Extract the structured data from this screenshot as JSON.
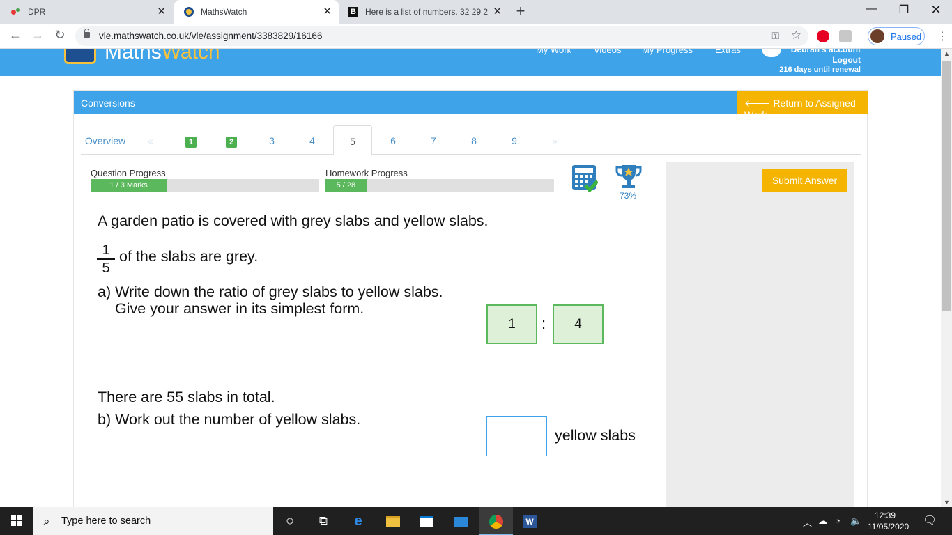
{
  "browser": {
    "tabs": [
      {
        "title": "DPR",
        "active": false
      },
      {
        "title": "MathsWatch",
        "active": true
      },
      {
        "title": "Here is a list of numbers. 32 29 2",
        "active": false
      }
    ],
    "url": "vle.mathswatch.co.uk/vle/assignment/3383829/16166",
    "profile_status": "Paused"
  },
  "site": {
    "logo_left": "Maths",
    "logo_right": "Watch",
    "nav": [
      "My Work",
      "Videos",
      "My Progress",
      "Extras"
    ],
    "account": "Debrah's account",
    "logout": "Logout",
    "renewal": "216 days until renewal"
  },
  "panel": {
    "title": "Conversions",
    "return_label": "Return to Assigned Work",
    "overview_label": "Overview",
    "prev_arrow": "«",
    "next_arrow": "»",
    "question_tabs": [
      {
        "label": "1",
        "state": "done"
      },
      {
        "label": "2",
        "state": "done"
      },
      {
        "label": "3",
        "state": "todo"
      },
      {
        "label": "4",
        "state": "todo"
      },
      {
        "label": "5",
        "state": "active"
      },
      {
        "label": "6",
        "state": "todo"
      },
      {
        "label": "7",
        "state": "todo"
      },
      {
        "label": "8",
        "state": "todo"
      },
      {
        "label": "9",
        "state": "todo"
      }
    ],
    "question_progress": {
      "label": "Question Progress",
      "text": "1 / 3 Marks",
      "fraction": 0.333
    },
    "homework_progress": {
      "label": "Homework Progress",
      "text": "5 / 28",
      "fraction": 0.179
    },
    "trophy_percent": "73%",
    "submit_label": "Submit Answer"
  },
  "question": {
    "line1": "A garden patio is covered with grey slabs and yellow slabs.",
    "fraction_num": "1",
    "fraction_den": "5",
    "line2": "of the slabs are grey.",
    "part_a_1": "a) Write down the ratio of grey slabs to yellow slabs.",
    "part_a_2": "Give your answer in its simplest form.",
    "ratio_left": "1",
    "ratio_sep": ":",
    "ratio_right": "4",
    "line3": "There are 55 slabs in total.",
    "part_b": "b) Work out the number of yellow slabs.",
    "answer_b": "",
    "answer_b_unit": "yellow slabs"
  },
  "taskbar": {
    "search_placeholder": "Type here to search",
    "time": "12:39",
    "date": "11/05/2020"
  }
}
